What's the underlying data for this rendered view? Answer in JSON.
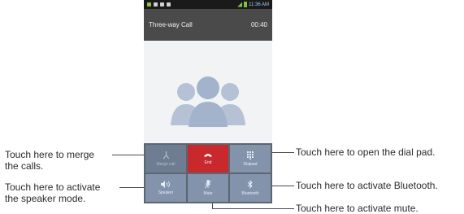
{
  "callouts": {
    "merge_line1": "Touch here to merge",
    "merge_line2": "the calls.",
    "speaker_line1": "Touch here to activate",
    "speaker_line2": "the speaker mode.",
    "dialpad": "Touch here to open the dial pad.",
    "bluetooth": "Touch here to activate Bluetooth.",
    "mute": "Touch here to activate mute."
  },
  "phone": {
    "status_time": "11:36 AM",
    "call_title": "Three-way Call",
    "call_duration": "00:40",
    "buttons": {
      "merge": "Merge call",
      "end": "End",
      "dialpad": "Dialpad",
      "speaker": "Speaker",
      "mute": "Mute",
      "bluetooth": "Bluetooth"
    }
  },
  "colors": {
    "end_button": "#c9292c",
    "call_button": "#8393ab",
    "title_bar": "#4a4a4a"
  },
  "icons": [
    "merge-icon",
    "end-call-icon",
    "dialpad-icon",
    "speaker-icon",
    "mute-icon",
    "bluetooth-icon",
    "contacts-group-icon"
  ]
}
